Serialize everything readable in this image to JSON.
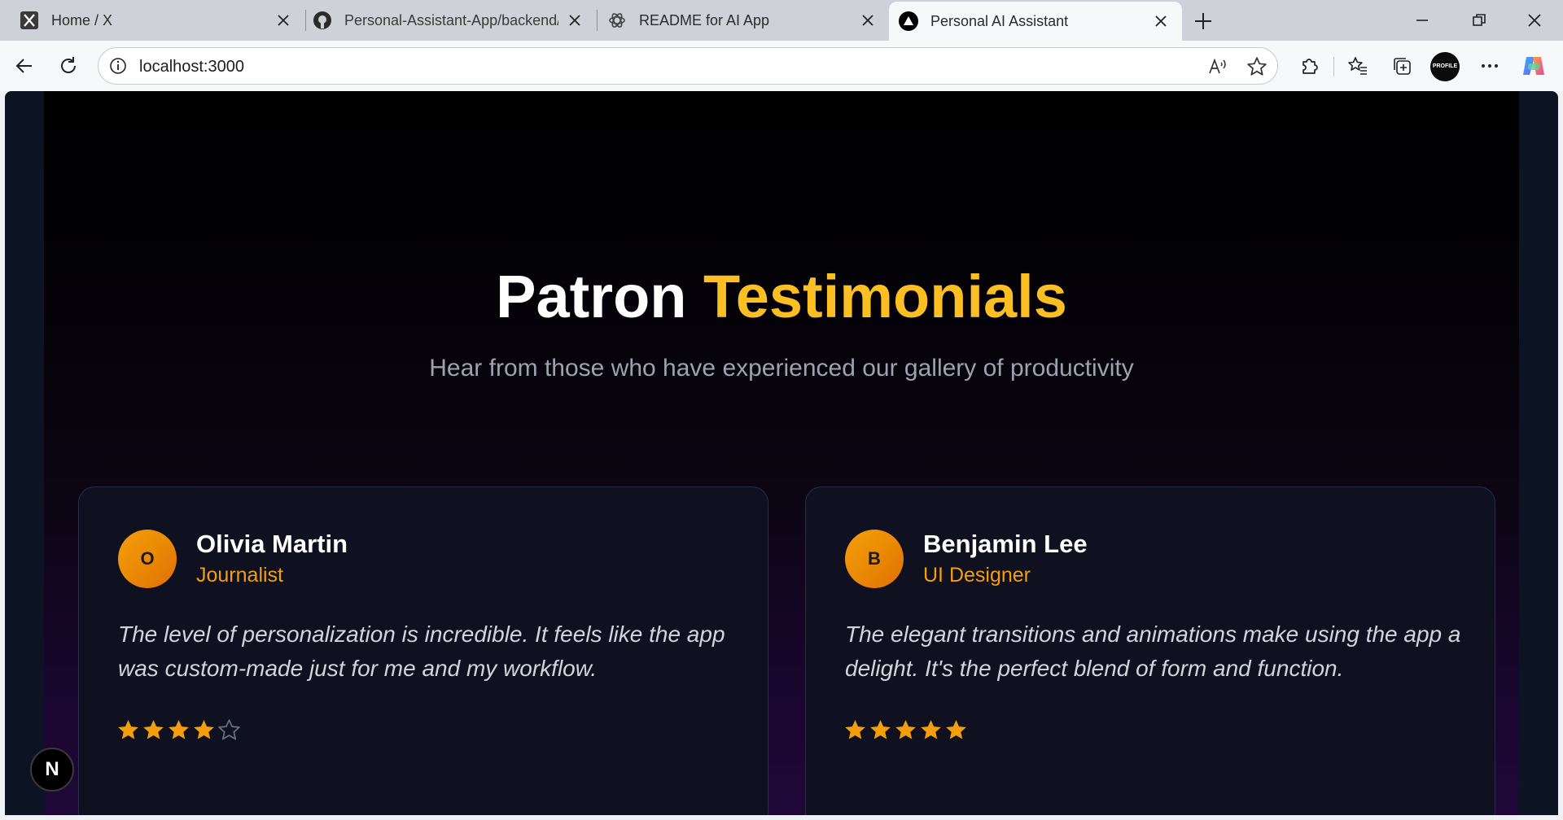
{
  "browser": {
    "tabs": [
      {
        "title": "Home / X",
        "icon": "x-logo-icon"
      },
      {
        "title": "Personal-Assistant-App/backend/",
        "icon": "github-icon"
      },
      {
        "title": "README for AI App",
        "icon": "openai-icon"
      },
      {
        "title": "Personal AI Assistant",
        "icon": "triangle-logo-icon",
        "active": true
      }
    ],
    "address": "localhost:3000",
    "profile_text": "PROFILE"
  },
  "page": {
    "heading_prefix": "Patron",
    "heading_accent": "Testimonials",
    "subheading": "Hear from those who have experienced our gallery of productivity",
    "testimonials": [
      {
        "initial": "O",
        "name": "Olivia Martin",
        "role": "Journalist",
        "quote": "The level of personalization is incredible. It feels like the app was custom-made just for me and my workflow.",
        "rating": 4,
        "max_rating": 5
      },
      {
        "initial": "B",
        "name": "Benjamin Lee",
        "role": "UI Designer",
        "quote": "The elegant transitions and animations make using the app a delight. It's the perfect blend of form and function.",
        "rating": 5,
        "max_rating": 5
      }
    ],
    "dev_badge": "N"
  },
  "colors": {
    "accent": "#fbbf24",
    "role": "#f59e0b",
    "star_filled": "#f59e0b",
    "star_empty": "#6b7280"
  }
}
